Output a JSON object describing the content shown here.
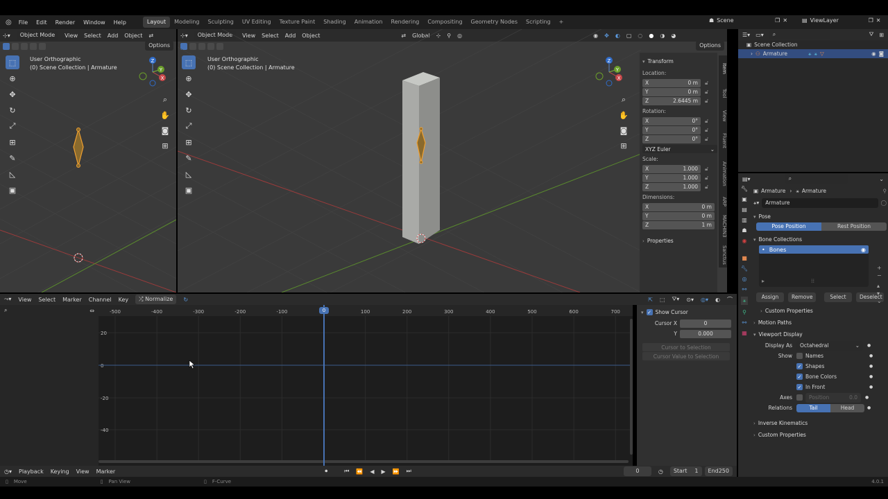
{
  "menu": {
    "items": [
      "File",
      "Edit",
      "Render",
      "Window",
      "Help"
    ]
  },
  "workspaces": [
    {
      "label": "Layout",
      "active": true
    },
    {
      "label": "Modeling"
    },
    {
      "label": "Sculpting"
    },
    {
      "label": "UV Editing"
    },
    {
      "label": "Texture Paint"
    },
    {
      "label": "Shading"
    },
    {
      "label": "Animation"
    },
    {
      "label": "Rendering"
    },
    {
      "label": "Compositing"
    },
    {
      "label": "Geometry Nodes"
    },
    {
      "label": "Scripting"
    }
  ],
  "scene": {
    "name": "Scene",
    "view_layer": "ViewLayer"
  },
  "viewport_left": {
    "mode": "Object Mode",
    "menus": [
      "View",
      "Select",
      "Add",
      "Object"
    ],
    "options": "Options",
    "overlay_line1": "User Orthographic",
    "overlay_line2": "(0) Scene Collection | Armature"
  },
  "viewport_main": {
    "mode": "Object Mode",
    "menus": [
      "View",
      "Select",
      "Add",
      "Object"
    ],
    "orientation": "Global",
    "options": "Options",
    "overlay_line1": "User Orthographic",
    "overlay_line2": "(0) Scene Collection | Armature"
  },
  "gizmo": {
    "x": "X",
    "y": "Y",
    "z": "Z"
  },
  "npanel": {
    "title": "Transform",
    "location_label": "Location:",
    "location": [
      {
        "axis": "X",
        "value": "0 m"
      },
      {
        "axis": "Y",
        "value": "0 m"
      },
      {
        "axis": "Z",
        "value": "2.6445 m"
      }
    ],
    "rotation_label": "Rotation:",
    "rotation": [
      {
        "axis": "X",
        "value": "0°"
      },
      {
        "axis": "Y",
        "value": "0°"
      },
      {
        "axis": "Z",
        "value": "0°"
      }
    ],
    "rotation_mode": "XYZ Euler",
    "scale_label": "Scale:",
    "scale": [
      {
        "axis": "X",
        "value": "1.000"
      },
      {
        "axis": "Y",
        "value": "1.000"
      },
      {
        "axis": "Z",
        "value": "1.000"
      }
    ],
    "dimensions_label": "Dimensions:",
    "dimensions": [
      {
        "axis": "X",
        "value": "0 m"
      },
      {
        "axis": "Y",
        "value": "0 m"
      },
      {
        "axis": "Z",
        "value": "1 m"
      }
    ],
    "properties": "Properties",
    "tabs": [
      "Item",
      "Tool",
      "View",
      "Fluent",
      "Animation",
      "ARP",
      "MACHIN3",
      "Sanctus"
    ]
  },
  "outliner": {
    "collection": "Scene Collection",
    "item": "Armature"
  },
  "properties": {
    "breadcrumb1": "Armature",
    "breadcrumb2": "Armature",
    "data_name": "Armature",
    "pose_section": "Pose",
    "pose_position": "Pose Position",
    "rest_position": "Rest Position",
    "bone_collections": "Bone Collections",
    "bones": "Bones",
    "assign": "Assign",
    "remove": "Remove",
    "select": "Select",
    "deselect": "Deselect",
    "custom_props_inner": "Custom Properties",
    "motion_paths": "Motion Paths",
    "viewport_display": "Viewport Display",
    "display_as_label": "Display As",
    "display_as": "Octahedral",
    "show_label": "Show",
    "names": "Names",
    "shapes": "Shapes",
    "bone_colors": "Bone Colors",
    "in_front": "In Front",
    "axes_label": "Axes",
    "position_label": "Position",
    "position_value": "0.0",
    "relations_label": "Relations",
    "tail": "Tail",
    "head": "Head",
    "inverse_kinematics": "Inverse Kinematics",
    "custom_properties": "Custom Properties"
  },
  "graph": {
    "menus": [
      "View",
      "Select",
      "Marker",
      "Channel",
      "Key"
    ],
    "normalize": "Normalize",
    "frame_ticks": [
      "-500",
      "-400",
      "-300",
      "-200",
      "-100",
      "0",
      "100",
      "200",
      "300",
      "400",
      "500",
      "600",
      "700"
    ],
    "value_ticks": [
      "20",
      "0",
      "-20",
      "-40"
    ],
    "current_frame": "0",
    "show_cursor": "Show Cursor",
    "cursor_x_label": "Cursor X",
    "cursor_x": "0",
    "cursor_y_label": "Y",
    "cursor_y": "0.000",
    "cursor_to_selection": "Cursor to Selection",
    "cursor_value_to_selection": "Cursor Value to Selection"
  },
  "timeline": {
    "menus": [
      "Playback",
      "Keying",
      "View",
      "Marker"
    ],
    "frame": "0",
    "start_label": "Start",
    "start": "1",
    "end_label": "End",
    "end": "250"
  },
  "status": {
    "move": "Move",
    "pan_view": "Pan View",
    "f_curve": "F-Curve",
    "version": "4.0.1"
  }
}
